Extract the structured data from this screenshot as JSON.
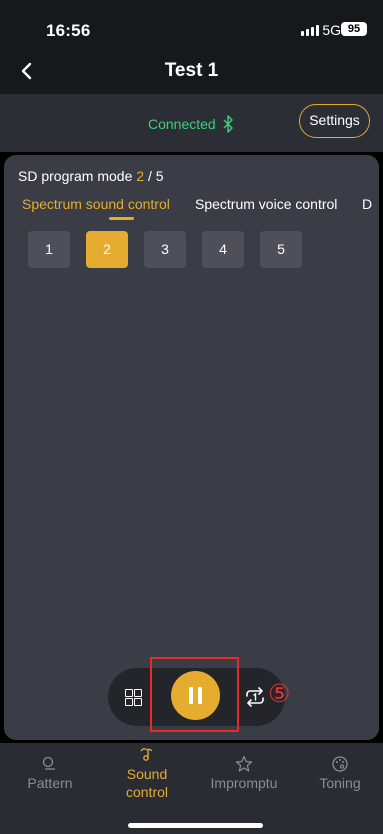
{
  "status_bar": {
    "time": "16:56",
    "network": "5G",
    "battery": "95"
  },
  "nav": {
    "title": "Test 1"
  },
  "connection": {
    "status": "Connected",
    "settings_label": "Settings"
  },
  "mode": {
    "prefix": "SD program mode ",
    "current": "2",
    "separator": " / ",
    "total": "5"
  },
  "tabs": [
    "Spectrum sound control",
    "Spectrum voice control",
    "D"
  ],
  "numbers": [
    "1",
    "2",
    "3",
    "4",
    "5"
  ],
  "selected_number": "2",
  "annotation_marker": "⑤",
  "bottom_tabs": [
    {
      "label": "Pattern",
      "icon": "pattern-icon"
    },
    {
      "label": "Sound control",
      "icon": "sound-control-icon"
    },
    {
      "label": "Impromptu",
      "icon": "impromptu-icon"
    },
    {
      "label": "Toning",
      "icon": "palette-icon"
    }
  ],
  "colors": {
    "accent": "#e5ac30",
    "connected": "#3dd07a",
    "annotation": "#ea2a2a"
  }
}
